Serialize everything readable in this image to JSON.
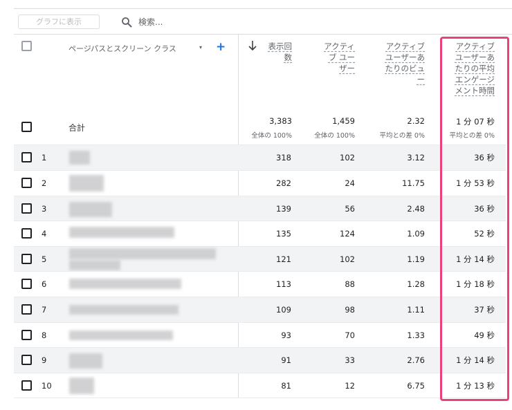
{
  "toolbar": {
    "graph_button_label": "グラフに表示",
    "search_placeholder": "検索..."
  },
  "dimension": {
    "header_label": "ページパスとスクリーン クラス",
    "dropdown_glyph": "▾",
    "add_glyph": "+"
  },
  "metrics": {
    "headers": [
      [
        "表示回",
        "数"
      ],
      [
        "アクティ",
        "ブ ユー",
        "ザー"
      ],
      [
        "アクティブ",
        "ユーザーあ",
        "たりのビュ",
        "ー"
      ],
      [
        "アクティブ",
        "ユーザーあ",
        "たりの平均",
        "エンゲージ",
        "メント時間"
      ]
    ],
    "sort_direction": "descending"
  },
  "totals": {
    "label": "合計",
    "values": [
      "3,383",
      "1,459",
      "2.32",
      "1 分 07 秒"
    ],
    "subs": [
      "全体の 100%",
      "全体の 100%",
      "平均との差 0%",
      "平均との差 0%"
    ]
  },
  "rows": [
    {
      "num": "1",
      "views": "318",
      "users": "102",
      "views_per_user": "3.12",
      "engagement": "36 秒"
    },
    {
      "num": "2",
      "views": "282",
      "users": "24",
      "views_per_user": "11.75",
      "engagement": "1 分 53 秒"
    },
    {
      "num": "3",
      "views": "139",
      "users": "56",
      "views_per_user": "2.48",
      "engagement": "36 秒"
    },
    {
      "num": "4",
      "views": "135",
      "users": "124",
      "views_per_user": "1.09",
      "engagement": "52 秒"
    },
    {
      "num": "5",
      "views": "121",
      "users": "102",
      "views_per_user": "1.19",
      "engagement": "1 分 14 秒"
    },
    {
      "num": "6",
      "views": "113",
      "users": "88",
      "views_per_user": "1.28",
      "engagement": "1 分 18 秒"
    },
    {
      "num": "7",
      "views": "109",
      "users": "98",
      "views_per_user": "1.11",
      "engagement": "37 秒"
    },
    {
      "num": "8",
      "views": "93",
      "users": "70",
      "views_per_user": "1.33",
      "engagement": "49 秒"
    },
    {
      "num": "9",
      "views": "91",
      "users": "33",
      "views_per_user": "2.76",
      "engagement": "1 分 14 秒"
    },
    {
      "num": "10",
      "views": "81",
      "users": "12",
      "views_per_user": "6.75",
      "engagement": "1 分 13 秒"
    }
  ],
  "colors": {
    "highlight": "#ec407a",
    "accent": "#1a73e8",
    "row_shade": "#f1f3f4"
  }
}
